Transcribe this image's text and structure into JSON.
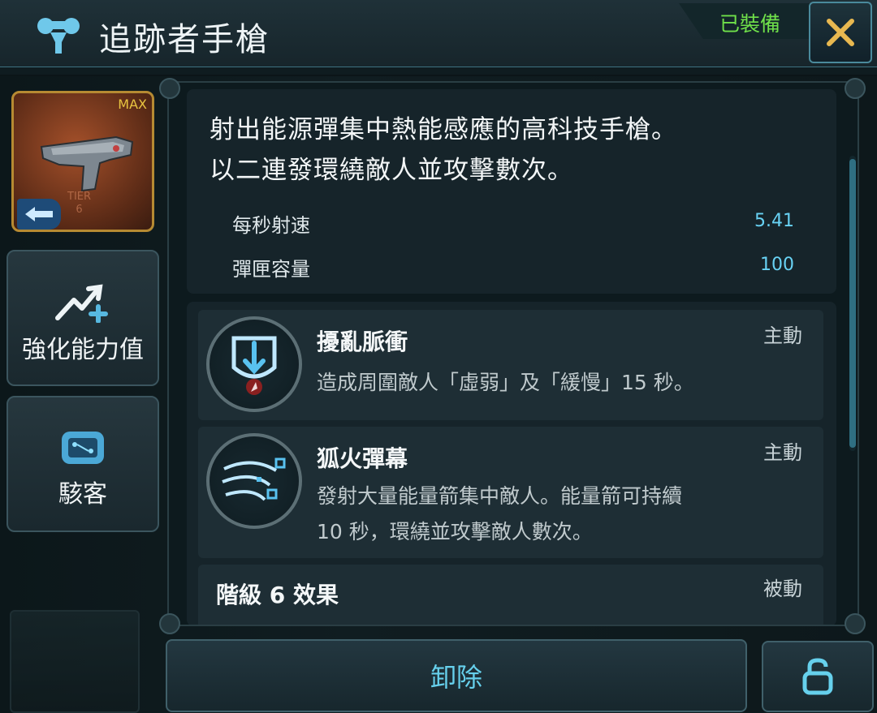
{
  "header": {
    "title": "追跡者手槍",
    "equipped_status": "已裝備",
    "icon": "weapon-category-icon",
    "close_icon": "close-icon"
  },
  "weapon": {
    "max_label": "MAX",
    "tier_text": "TIER\n6",
    "badge_icon": "arrow-left-icon"
  },
  "sidebar": {
    "items": [
      {
        "label": "強化能力值",
        "icon": "upgrade-arrow-icon"
      },
      {
        "label": "駭客",
        "icon": "hack-chip-icon"
      }
    ]
  },
  "description": {
    "lines": [
      "射出能源彈集中熱能感應的高科技手槍。",
      "以二連發環繞敵人並攻擊數次。"
    ],
    "stats": [
      {
        "name": "每秒射速",
        "value": "5.41"
      },
      {
        "name": "彈匣容量",
        "value": "100"
      }
    ]
  },
  "skills": [
    {
      "name": "擾亂脈衝",
      "type": "主動",
      "desc": "造成周圍敵人「虛弱」及「緩慢」15 秒。",
      "icon": "pulse-shield-icon"
    },
    {
      "name": "狐火彈幕",
      "type": "主動",
      "desc": "發射大量能量箭集中敵人。能量箭可持續\n10 秒，環繞並攻擊敵人數次。",
      "icon": "homing-arrows-icon"
    },
    {
      "name": "階級 6 效果",
      "type": "被動"
    }
  ],
  "footer": {
    "unequip_label": "卸除",
    "lock_icon": "lock-icon"
  },
  "colors": {
    "accent_cyan": "#66d0ec",
    "equipped_green": "#6fe04a",
    "max_gold": "#e8c440",
    "close_gold": "#e8b850"
  }
}
